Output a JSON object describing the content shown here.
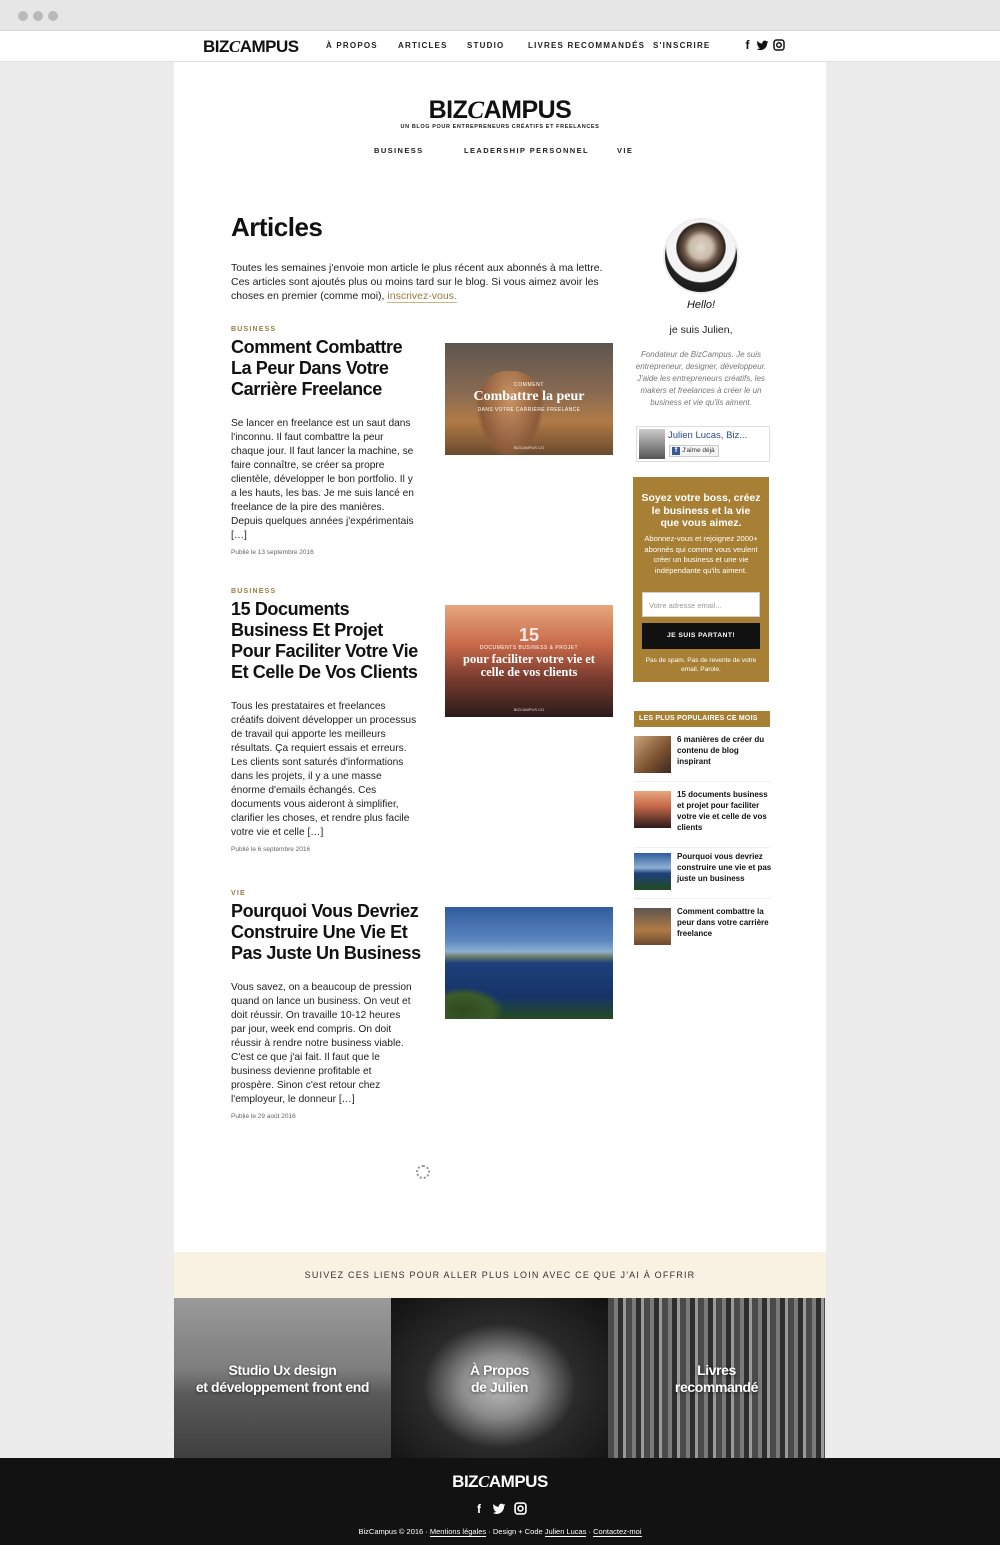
{
  "brand": {
    "logo_a": "BIZ",
    "logo_c": "C",
    "logo_b": "AMPUS"
  },
  "topnav": {
    "items": [
      "À PROPOS",
      "ARTICLES",
      "STUDIO",
      "LIVRES RECOMMANDÉS",
      "S'INSCRIRE"
    ],
    "social": [
      "f",
      "t",
      "◘"
    ]
  },
  "masthead": {
    "tagline": "UN BLOG POUR ENTREPRENEURS CRÉATIFS ET FREELANCES",
    "categories": [
      "BUSINESS",
      "LEADERSHIP PERSONNEL",
      "VIE"
    ]
  },
  "main": {
    "title": "Articles",
    "intro": "Toutes les semaines j'envoie mon article le plus récent aux abonnés à ma lettre. Ces articles sont ajoutés plus ou moins tard sur le blog. Si vous aimez avoir les choses en premier (comme moi), ",
    "intro_link": "inscrivez-vous.",
    "posts": [
      {
        "category": "BUSINESS",
        "title": "Comment Combattre La Peur Dans Votre Carrière Freelance",
        "excerpt": "Se lancer en freelance est un saut dans l'inconnu. Il faut combattre la peur chaque jour. Il faut lancer la machine, se faire connaître, se créer sa propre clientèle, développer le bon portfolio. Il y a les hauts, les bas. Je me suis lancé en freelance de la pire des manières. Depuis quelques années j'expérimentais […]",
        "date": "Publié le 13 septembre 2016",
        "thumb_small": "COMMENT",
        "thumb_big": "Combattre la peur",
        "thumb_sub": "DANS VOTRE CARRIÈRE FREELANCE",
        "thumb_foot": "BIZCAMPUS.CO"
      },
      {
        "category": "BUSINESS",
        "title": "15 Documents Business Et Projet Pour Faciliter Votre Vie Et Celle De Vos Clients",
        "excerpt": "Tous les prestataires et freelances créatifs doivent développer un processus de travail qui apporte les meilleurs résultats. Ça requiert essais et erreurs. Les clients sont saturés d'informations dans les projets, il y a une masse énorme d'emails échangés. Ces documents vous aideront à simplifier, clarifier les choses, et rendre plus facile votre vie et celle […]",
        "date": "Publié le 6 septembre 2016",
        "thumb_num": "15",
        "thumb_small": "DOCUMENTS BUSINESS & PROJET",
        "thumb_big": "pour faciliter votre vie et celle de vos clients",
        "thumb_foot": "BIZCAMPUS.CO"
      },
      {
        "category": "VIE",
        "title": "Pourquoi Vous Devriez Construire Une Vie Et Pas Juste Un Business",
        "excerpt": "Vous savez, on a beaucoup de pression quand on lance un business. On veut et doit réussir. On travaille 10-12 heures par jour, week end compris. On doit réussir à rendre notre business viable. C'est ce que j'ai fait. Il faut que le business devienne profitable et prospère. Sinon c'est retour chez l'employeur, le donneur […]",
        "date": "Publié le 29 août 2016"
      }
    ]
  },
  "sidebar": {
    "hello": "Hello!",
    "intro": "je suis Julien,",
    "bio": "Fondateur de BizCampus. Je suis entrepreneur, designer, développeur. J'aide les entrepreneurs créatifs, les makers et freelances à créer le un business et vie qu'ils aiment.",
    "fb_name": "Julien Lucas, Biz...",
    "fb_like": "J'aime déjà",
    "optin": {
      "heading": "Soyez votre boss, créez le business et la vie que vous aimez.",
      "body": "Abonnez-vous et rejoignez 2000+ abonnés qui comme vous veulent créer un business et une vie indépendante qu'ils aiment.",
      "placeholder": "Votre adresse email...",
      "button": "JE SUIS PARTANT!",
      "note": "Pas de spam. Pas de revente de votre email. Parole."
    },
    "popular_title": "LES PLUS POPULAIRES CE MOIS",
    "popular": [
      "6 manières de créer du contenu de blog inspirant",
      "15 documents business et projet pour faciliter votre vie et celle de vos clients",
      "Pourquoi vous devriez construire une vie et pas juste un business",
      "Comment combattre la peur dans votre carrière freelance"
    ]
  },
  "band": {
    "text": "SUIVEZ CES LIENS POUR ALLER PLUS LOIN AVEC CE QUE J'AI À OFFRIR"
  },
  "tiles": [
    {
      "line1": "Studio Ux design",
      "line2": "et développement front end"
    },
    {
      "line1": "À Propos",
      "line2": "de Julien"
    },
    {
      "line1": "Livres",
      "line2": "recommandé"
    }
  ],
  "footer": {
    "copy": "BizCampus © 2016 · ",
    "legal": "Mentions légales",
    "mid": " · Design + Code ",
    "author": "Julien Lucas",
    "sep": " · ",
    "contact": "Contactez-moi"
  },
  "colors": {
    "accent": "#a78035",
    "link": "#9a7b3e",
    "band": "#f9f1e2",
    "footer": "#121212"
  }
}
